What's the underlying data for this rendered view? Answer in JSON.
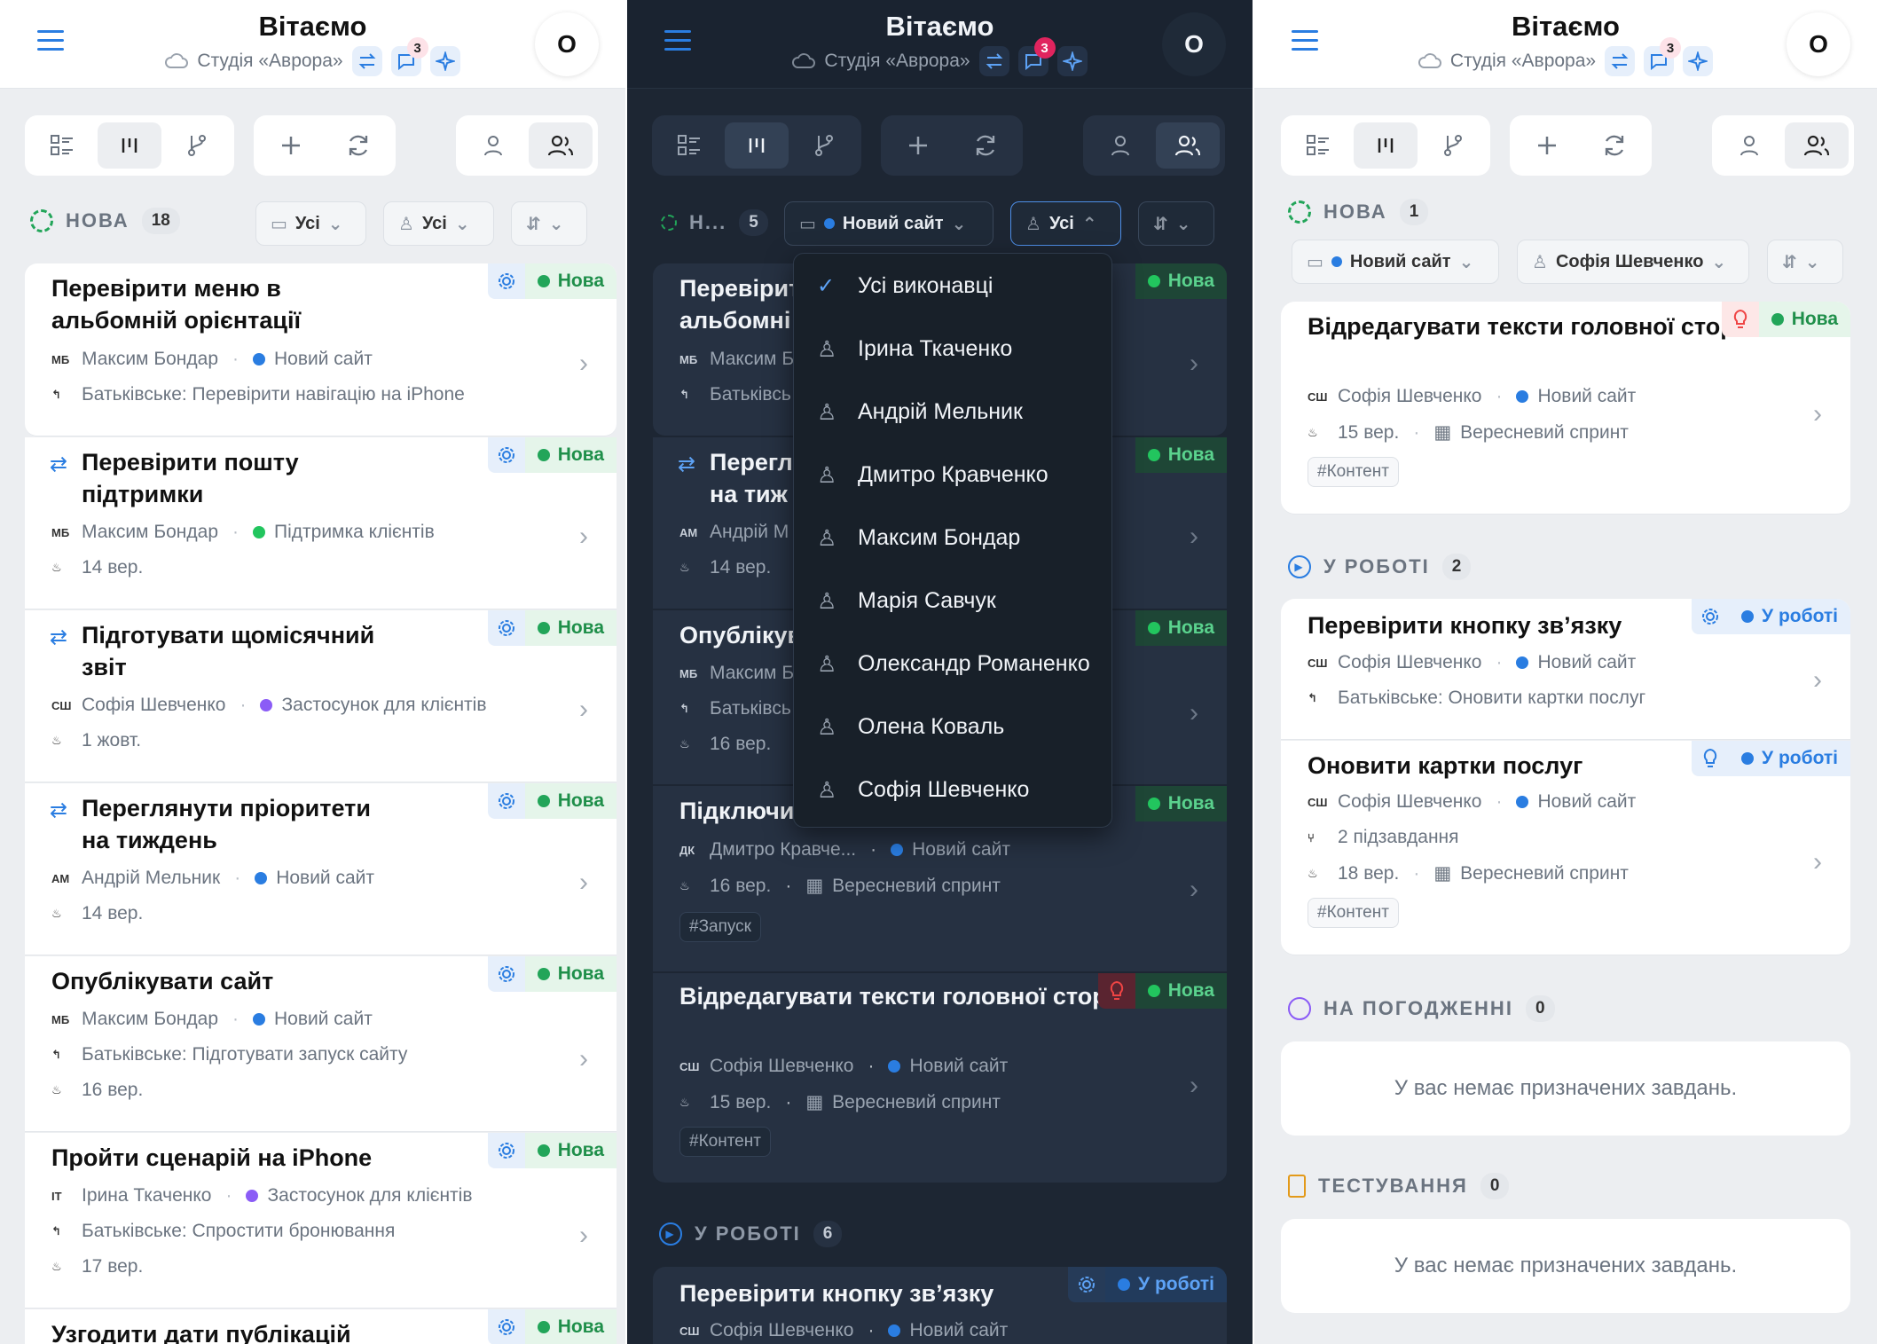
{
  "colors": {
    "accent": "#2a7de1",
    "status_new": "#22a559",
    "status_work": "#2a7de1",
    "purple": "#8b5cf6",
    "green": "#22c55e"
  },
  "header": {
    "title": "Вітаємо",
    "subtitle": "Студія «Аврора»",
    "notif_count": "3",
    "avatar": "О"
  },
  "panel1": {
    "section": {
      "label": "НОВА",
      "count": "18"
    },
    "filters": {
      "project": "Усі",
      "assignee": "Усі"
    },
    "cards": [
      {
        "title": "Перевірити меню в альбомній орієнтації",
        "ini": "МБ",
        "person": "Максим Бондар",
        "project": "Новий сайт",
        "line3": "Батьківське: Перевірити навігацію на iPhone",
        "status": "Нова"
      },
      {
        "title": "Перевірити пошту підтримки",
        "ini": "МБ",
        "person": "Максим Бондар",
        "project": "Підтримка клієнтів",
        "line3": "14 вер.",
        "status": "Нова"
      },
      {
        "title": "Підготувати щомісячний звіт",
        "ini": "СШ",
        "person": "Софія Шевченко",
        "project": "Застосунок для клієнтів",
        "line3": "1 жовт.",
        "status": "Нова"
      },
      {
        "title": "Переглянути пріоритети на тиждень",
        "ini": "АМ",
        "person": "Андрій Мельник",
        "project": "Новий сайт",
        "line3": "14 вер.",
        "status": "Нова"
      },
      {
        "title": "Опублікувати сайт",
        "ini": "МБ",
        "person": "Максим Бондар",
        "project": "Новий сайт",
        "line3": "Батьківське: Підготувати запуск сайту",
        "line4": "16 вер.",
        "status": "Нова"
      },
      {
        "title": "Пройти сценарій на iPhone",
        "ini": "ІТ",
        "person": "Ірина Ткаченко",
        "project": "Застосунок для клієнтів",
        "line3": "Батьківське: Спростити бронювання",
        "line4": "17 вер.",
        "status": "Нова"
      },
      {
        "title": "Узгодити дати публікацій",
        "status": "Нова"
      }
    ]
  },
  "panel2": {
    "section": {
      "label": "Н...",
      "count": "5"
    },
    "filters": {
      "project": "Новий сайт",
      "assignee": "Усі"
    },
    "dropdown": [
      "Усі виконавці",
      "Ірина Ткаченко",
      "Андрій Мельник",
      "Дмитро Кравченко",
      "Максим Бондар",
      "Марія Савчук",
      "Олександр Романенко",
      "Олена Коваль",
      "Софія Шевченко"
    ],
    "cards": [
      {
        "title": "Перевірит альбомні",
        "ini": "МБ",
        "person": "Максим Б",
        "line3": "Батьківсь",
        "status": "Нова"
      },
      {
        "title": "Перегл на тиж",
        "ini": "АМ",
        "person": "Андрій М",
        "line3": "14 вер.",
        "status": "Нова"
      },
      {
        "title": "Опублікув",
        "ini": "МБ",
        "person": "Максим Б",
        "line3": "Батьківсь",
        "line4": "16 вер.",
        "status": "Нова"
      },
      {
        "title": "Підключи",
        "ini": "ДК",
        "person": "Дмитро Кравче...",
        "project": "Новий сайт",
        "date": "16 вер.",
        "sprint": "Вересневий спринт",
        "tag": "#Запуск",
        "status": "Нова"
      },
      {
        "title": "Відредагувати тексти головної сторінки",
        "ini": "СШ",
        "person": "Софія Шевченко",
        "project": "Новий сайт",
        "date": "15 вер.",
        "sprint": "Вересневий спринт",
        "tag": "#Контент",
        "status": "Нова"
      }
    ],
    "section2": {
      "label": "У РОБОТІ",
      "count": "6"
    },
    "work_card": {
      "title": "Перевірити кнопку зв’язку",
      "ini": "СШ",
      "person": "Софія Шевченко",
      "project": "Новий сайт",
      "status": "У роботі"
    }
  },
  "panel3": {
    "section": {
      "label": "НОВА",
      "count": "1"
    },
    "filters": {
      "project": "Новий сайт",
      "assignee": "Софія Шевченко"
    },
    "card1": {
      "title": "Відредагувати тексти головної сторінки",
      "ini": "СШ",
      "person": "Софія Шевченко",
      "project": "Новий сайт",
      "date": "15 вер.",
      "sprint": "Вересневий спринт",
      "tag": "#Контент",
      "status": "Нова"
    },
    "section2": {
      "label": "У РОБОТІ",
      "count": "2"
    },
    "card2": {
      "title": "Перевірити кнопку зв’язку",
      "ini": "СШ",
      "person": "Софія Шевченко",
      "project": "Новий сайт",
      "line3": "Батьківське: Оновити картки послуг",
      "status": "У роботі"
    },
    "card3": {
      "title": "Оновити картки послуг",
      "ini": "СШ",
      "person": "Софія Шевченко",
      "project": "Новий сайт",
      "subtasks": "2 підзавдання",
      "date": "18 вер.",
      "sprint": "Вересневий спринт",
      "tag": "#Контент",
      "status": "У роботі"
    },
    "section3": {
      "label": "НА ПОГОДЖЕННІ",
      "count": "0"
    },
    "empty1": "У вас немає призначених завдань.",
    "section4": {
      "label": "ТЕСТУВАННЯ",
      "count": "0"
    },
    "empty2": "У вас немає призначених завдань."
  }
}
